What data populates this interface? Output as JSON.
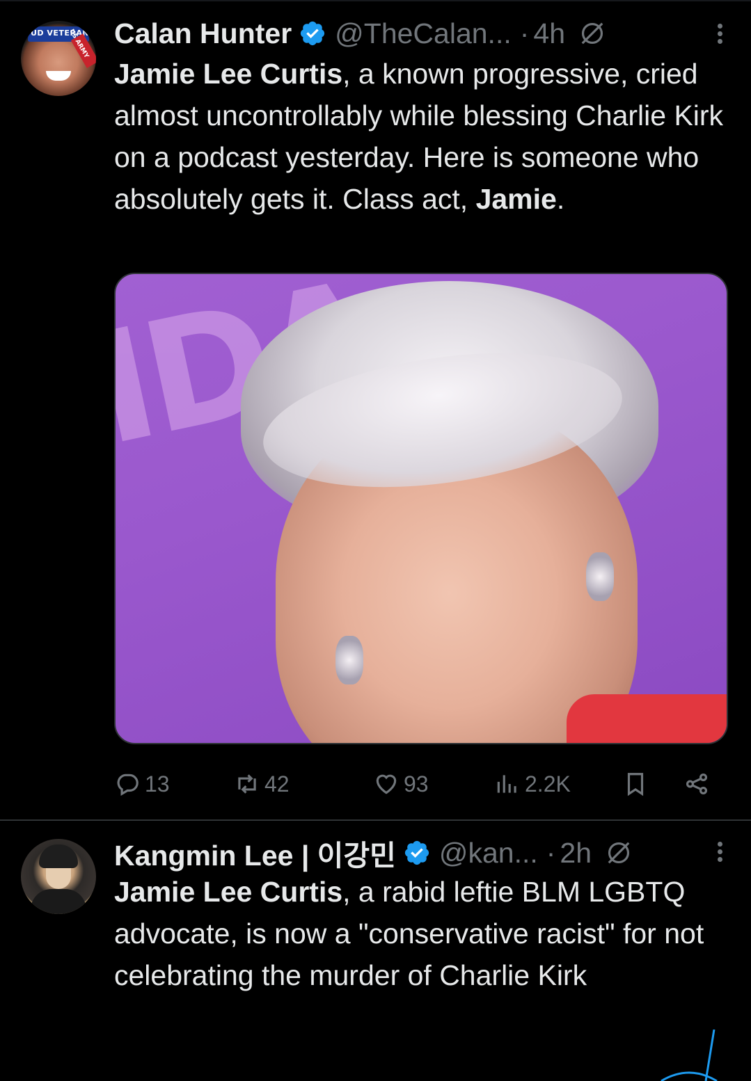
{
  "tweets": [
    {
      "author_name": "Calan Hunter",
      "handle": "@TheCalan...",
      "separator": "·",
      "time": "4h",
      "avatar_text": {
        "top": "UD VETERAN",
        "side": "US ARMY"
      },
      "body_parts": [
        {
          "text": "Jamie Lee Curtis",
          "bold": true
        },
        {
          "text": ", a known progressive, cried almost uncontrollably while blessing Charlie Kirk on a podcast yesterday. Here is someone who absolutely gets it. Class act, ",
          "bold": false
        },
        {
          "text": "Jamie",
          "bold": true
        },
        {
          "text": ".",
          "bold": false
        }
      ],
      "media_backdrop_text": "IDA",
      "actions": {
        "replies": "13",
        "reposts": "42",
        "likes": "93",
        "views": "2.2K"
      }
    },
    {
      "author_name": "Kangmin Lee | 이강민",
      "handle": "@kan...",
      "separator": "·",
      "time": "2h",
      "body_parts": [
        {
          "text": "Jamie Lee Curtis",
          "bold": true
        },
        {
          "text": ", a rabid leftie BLM LGBTQ advocate, is now a \"conservative racist\" for not celebrating the murder of Charlie Kirk",
          "bold": false
        }
      ]
    }
  ],
  "icons": {
    "verified": "verified-badge-icon",
    "grok": "grok-icon",
    "more": "more-options-icon",
    "reply": "reply-icon",
    "repost": "repost-icon",
    "like": "like-icon",
    "views": "views-icon",
    "bookmark": "bookmark-icon",
    "share": "share-icon"
  },
  "colors": {
    "background": "#000000",
    "text": "#e7e9ea",
    "secondary": "#71767b",
    "verified": "#1d9bf0",
    "divider": "#2f3336"
  }
}
